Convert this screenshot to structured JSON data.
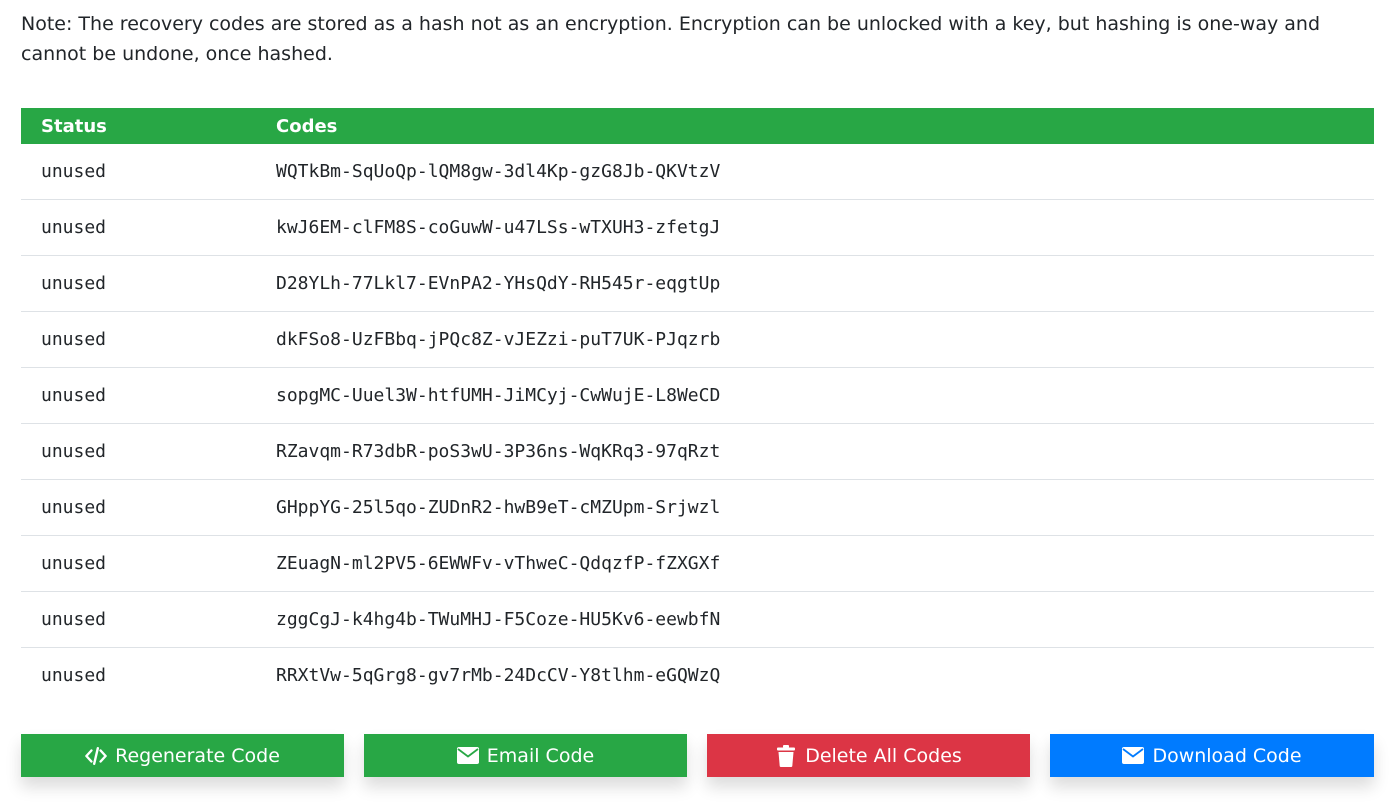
{
  "note": "Note: The recovery codes are stored as a hash not as an encryption. Encryption can be unlocked with a key, but hashing is one-way and cannot be undone, once hashed.",
  "table": {
    "headers": {
      "status": "Status",
      "codes": "Codes"
    },
    "rows": [
      {
        "status": "unused",
        "code": "WQTkBm-SqUoQp-lQM8gw-3dl4Kp-gzG8Jb-QKVtzV"
      },
      {
        "status": "unused",
        "code": "kwJ6EM-clFM8S-coGuwW-u47LSs-wTXUH3-zfetgJ"
      },
      {
        "status": "unused",
        "code": "D28YLh-77Lkl7-EVnPA2-YHsQdY-RH545r-eqgtUp"
      },
      {
        "status": "unused",
        "code": "dkFSo8-UzFBbq-jPQc8Z-vJEZzi-puT7UK-PJqzrb"
      },
      {
        "status": "unused",
        "code": "sopgMC-Uuel3W-htfUMH-JiMCyj-CwWujE-L8WeCD"
      },
      {
        "status": "unused",
        "code": "RZavqm-R73dbR-poS3wU-3P36ns-WqKRq3-97qRzt"
      },
      {
        "status": "unused",
        "code": "GHppYG-25l5qo-ZUDnR2-hwB9eT-cMZUpm-Srjwzl"
      },
      {
        "status": "unused",
        "code": "ZEuagN-ml2PV5-6EWWFv-vThweC-QdqzfP-fZXGXf"
      },
      {
        "status": "unused",
        "code": "zggCgJ-k4hg4b-TWuMHJ-F5Coze-HU5Kv6-eewbfN"
      },
      {
        "status": "unused",
        "code": "RRXtVw-5qGrg8-gv7rMb-24DcCV-Y8tlhm-eGQWzQ"
      }
    ]
  },
  "buttons": {
    "regenerate": {
      "label": "Regenerate Code",
      "icon": "code-icon",
      "color": "#28a745"
    },
    "email": {
      "label": "Email Code",
      "icon": "envelope-icon",
      "color": "#28a745"
    },
    "delete": {
      "label": "Delete All Codes",
      "icon": "trash-icon",
      "color": "#dc3545"
    },
    "download": {
      "label": "Download Code",
      "icon": "envelope-icon",
      "color": "#007bff"
    }
  },
  "colors": {
    "header_bg": "#28a745",
    "text": "#212529",
    "row_border": "#dee2e6"
  }
}
